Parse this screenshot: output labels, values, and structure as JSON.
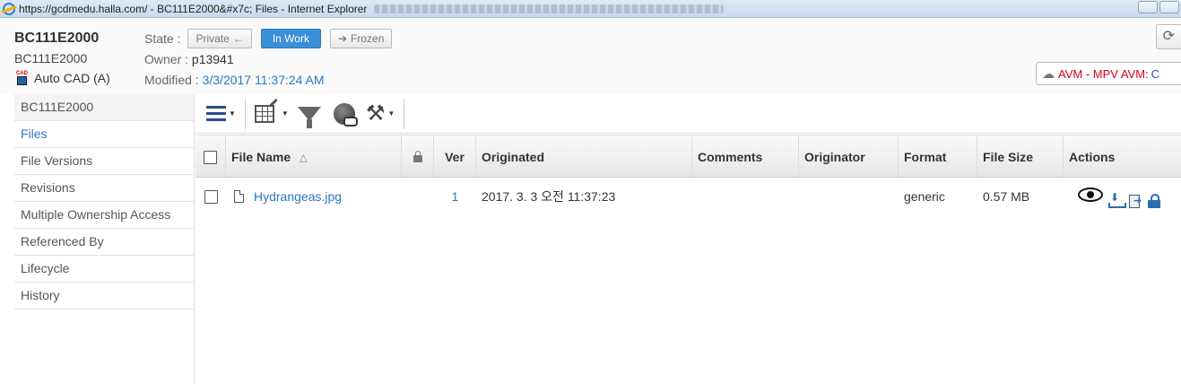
{
  "window": {
    "title": "https://gcdmedu.halla.com/ - BC111E2000&#x7c; Files - Internet Explorer"
  },
  "object": {
    "title": "BC111E2000",
    "subtitle": "BC111E2000",
    "type_label": "Auto CAD (A)",
    "type_icon_text": "CAD",
    "state_label": "State :",
    "states": {
      "prev": "Private",
      "current": "In Work",
      "next": "Frozen"
    },
    "owner_label": "Owner : ",
    "owner_value": "p13941",
    "modified_label": "Modified : ",
    "modified_value": "3/3/2017 11:37:24 AM"
  },
  "avm": {
    "label": "AVM - MPV AVM",
    "separator": " : ",
    "tail": "C"
  },
  "sidebar": {
    "items": [
      {
        "label": "BC111E2000"
      },
      {
        "label": "Files"
      },
      {
        "label": "File Versions"
      },
      {
        "label": "Revisions"
      },
      {
        "label": "Multiple Ownership Access"
      },
      {
        "label": "Referenced By"
      },
      {
        "label": "Lifecycle"
      },
      {
        "label": "History"
      }
    ]
  },
  "table": {
    "headers": {
      "file_name": "File Name",
      "sort_indicator": "△",
      "ver": "Ver",
      "originated": "Originated",
      "comments": "Comments",
      "originator": "Originator",
      "format": "Format",
      "file_size": "File Size",
      "actions": "Actions"
    },
    "rows": [
      {
        "file_name": "Hydrangeas.jpg",
        "ver": "1",
        "originated": "2017. 3. 3 오전 11:37:23",
        "comments": "",
        "originator": "",
        "format": "generic",
        "file_size": "0.57 MB"
      }
    ]
  },
  "colors": {
    "accent": "#3a8fd6",
    "link": "#2a78c2",
    "avm_red": "#d0021b"
  }
}
